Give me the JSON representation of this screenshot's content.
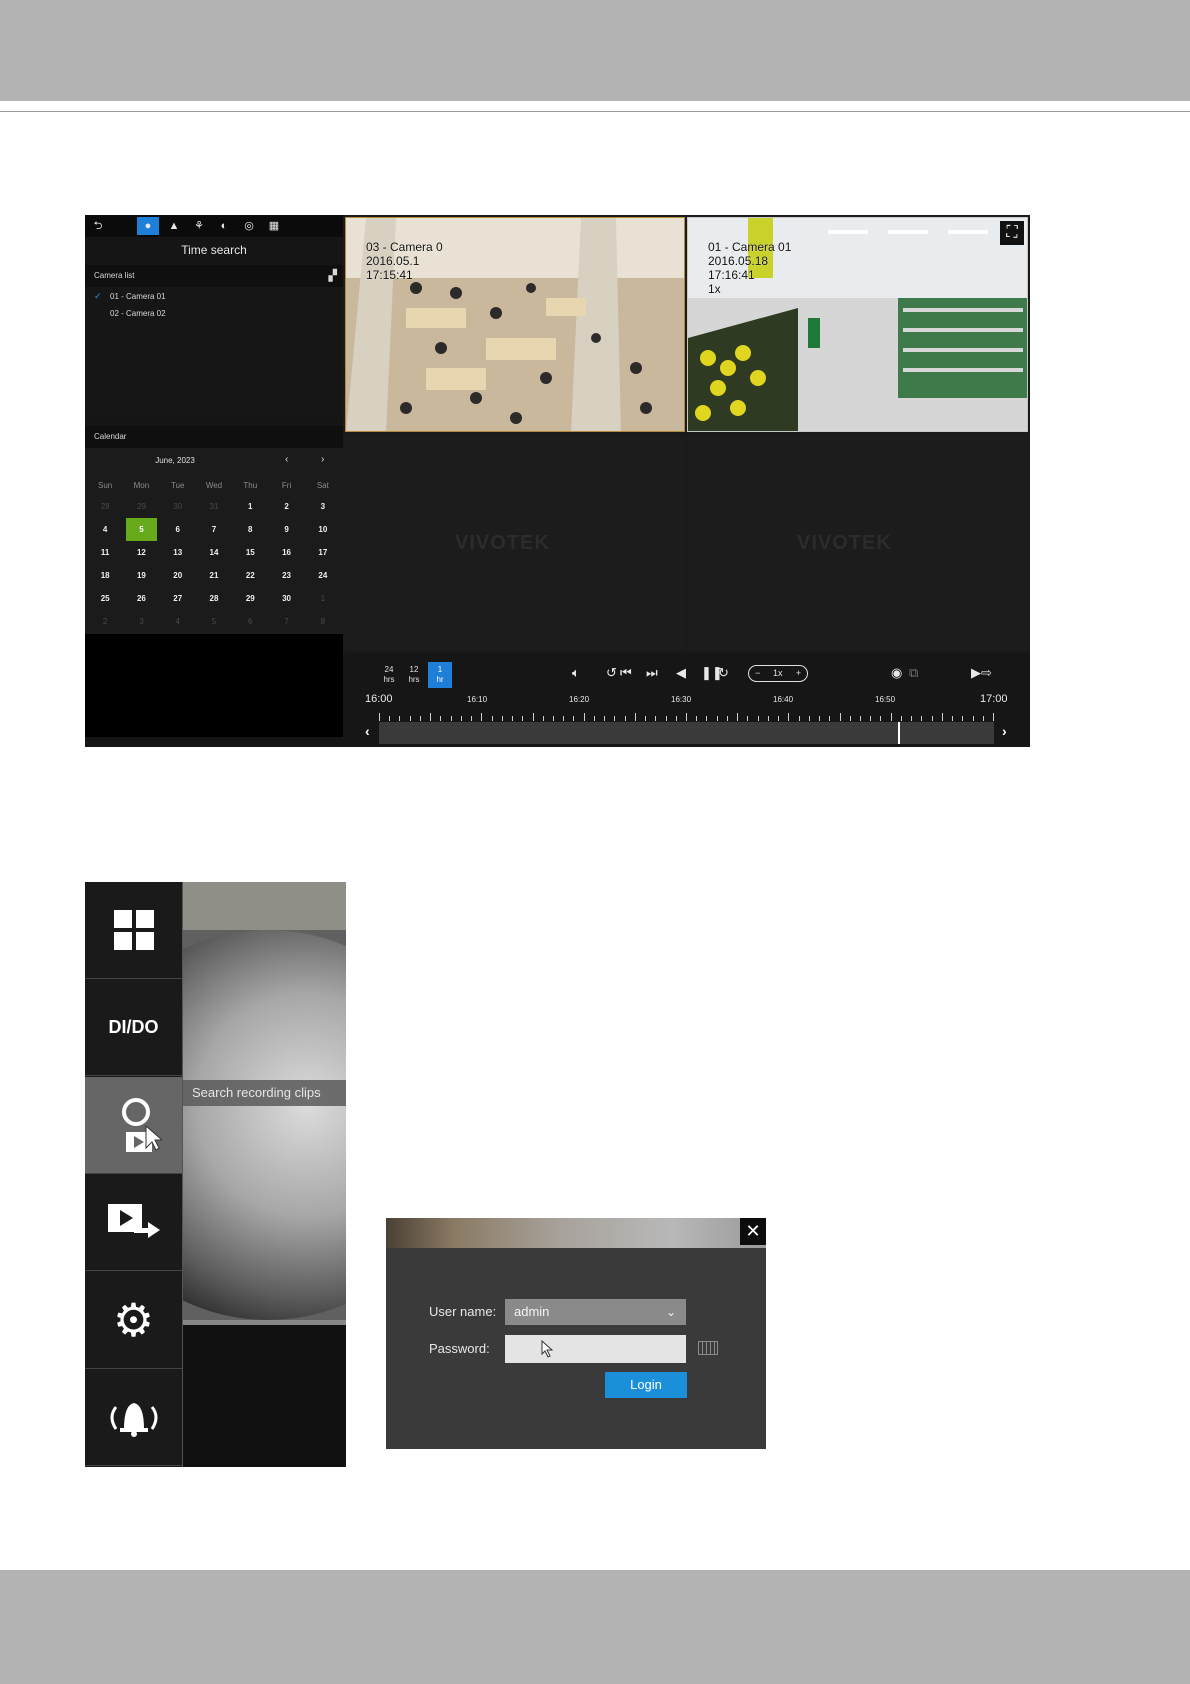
{
  "time_search": {
    "title": "Time search",
    "camera_list_header": "Camera list",
    "cameras": [
      "01 - Camera 01",
      "02 - Camera 02"
    ],
    "calendar_header": "Calendar",
    "calendar_month": "June, 2023",
    "weekdays": [
      "Sun",
      "Mon",
      "Tue",
      "Wed",
      "Thu",
      "Fri",
      "Sat"
    ],
    "days": [
      {
        "d": "28",
        "m": true
      },
      {
        "d": "29",
        "m": true
      },
      {
        "d": "30",
        "m": true
      },
      {
        "d": "31",
        "m": true
      },
      {
        "d": "1"
      },
      {
        "d": "2"
      },
      {
        "d": "3"
      },
      {
        "d": "4"
      },
      {
        "d": "5",
        "sel": true
      },
      {
        "d": "6"
      },
      {
        "d": "7"
      },
      {
        "d": "8"
      },
      {
        "d": "9"
      },
      {
        "d": "10"
      },
      {
        "d": "11"
      },
      {
        "d": "12"
      },
      {
        "d": "13"
      },
      {
        "d": "14"
      },
      {
        "d": "15"
      },
      {
        "d": "16"
      },
      {
        "d": "17"
      },
      {
        "d": "18"
      },
      {
        "d": "19"
      },
      {
        "d": "20"
      },
      {
        "d": "21"
      },
      {
        "d": "22"
      },
      {
        "d": "23"
      },
      {
        "d": "24"
      },
      {
        "d": "25"
      },
      {
        "d": "26"
      },
      {
        "d": "27"
      },
      {
        "d": "28"
      },
      {
        "d": "29"
      },
      {
        "d": "30"
      },
      {
        "d": "1",
        "m": true
      },
      {
        "d": "2",
        "m": true
      },
      {
        "d": "3",
        "m": true
      },
      {
        "d": "4",
        "m": true
      },
      {
        "d": "5",
        "m": true
      },
      {
        "d": "6",
        "m": true
      },
      {
        "d": "7",
        "m": true
      },
      {
        "d": "8",
        "m": true
      }
    ],
    "pane1_overlay": [
      "03 - Camera 0",
      "2016.05.1",
      "17:15:41"
    ],
    "pane2_overlay": [
      "01 - Camera 01",
      "2016.05.18",
      "17:16:41",
      "1x"
    ],
    "watermark": "VIVOTEK",
    "range_buttons": [
      {
        "top": "24",
        "bottom": "hrs"
      },
      {
        "top": "12",
        "bottom": "hrs"
      },
      {
        "top": "1",
        "bottom": "hr"
      }
    ],
    "speed": "1x",
    "speed_minus": "−",
    "speed_plus": "+",
    "timeline_start": "16:00",
    "timeline_end": "17:00",
    "timeline_marks": [
      "16:10",
      "16:20",
      "16:30",
      "16:40",
      "16:50"
    ]
  },
  "sidebar": {
    "dido_label": "DI/DO",
    "tooltip": "Search recording clips",
    "icons": [
      "layout-icon",
      "search-recording-icon",
      "export-clip-icon",
      "settings-gear-icon",
      "alarm-bell-icon"
    ]
  },
  "login": {
    "username_label": "User name:",
    "username_value": "admin",
    "password_label": "Password:",
    "login_button": "Login",
    "close_symbol": "✕"
  },
  "colors": {
    "accent_blue": "#1e7fd8",
    "selected_day_green": "#66aa1c",
    "login_blue": "#1b8fd9"
  }
}
